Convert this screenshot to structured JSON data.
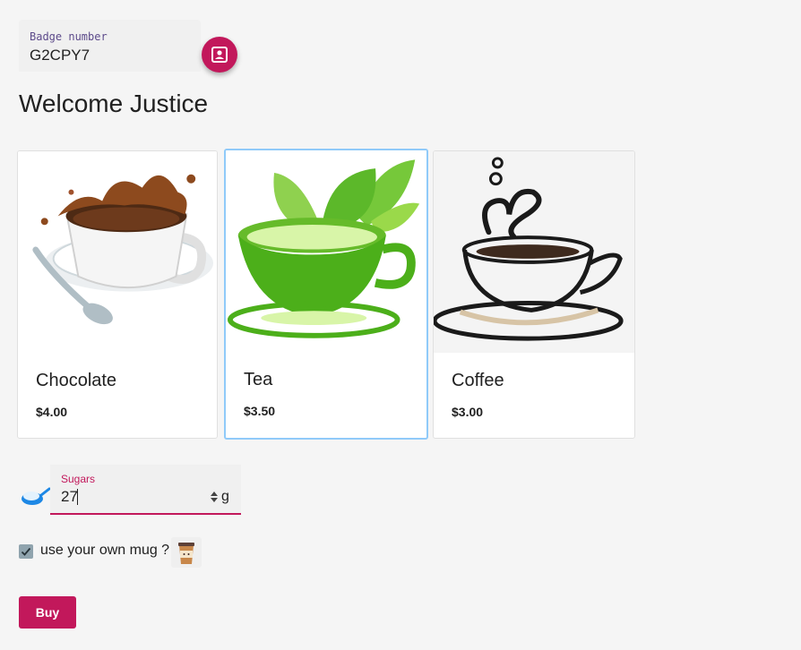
{
  "badge": {
    "label": "Badge number",
    "value": "G2CPY7",
    "icon": "badge-icon"
  },
  "welcome": "Welcome Justice",
  "drinks": [
    {
      "name": "Chocolate",
      "price": "$4.00",
      "icon": "chocolate-cup-icon",
      "selected": false
    },
    {
      "name": "Tea",
      "price": "$3.50",
      "icon": "tea-cup-icon",
      "selected": true
    },
    {
      "name": "Coffee",
      "price": "$3.00",
      "icon": "coffee-cup-icon",
      "selected": false
    }
  ],
  "sugars": {
    "label": "Sugars",
    "value": "27",
    "unit": "g",
    "icon": "sugar-spoon-icon"
  },
  "mug": {
    "label": "use your own mug ?",
    "checked": true,
    "icon": "mug-icon"
  },
  "buy_label": "Buy",
  "colors": {
    "accent": "#c2185b",
    "selected_border": "#90caf9",
    "background": "#f5f5f5"
  }
}
